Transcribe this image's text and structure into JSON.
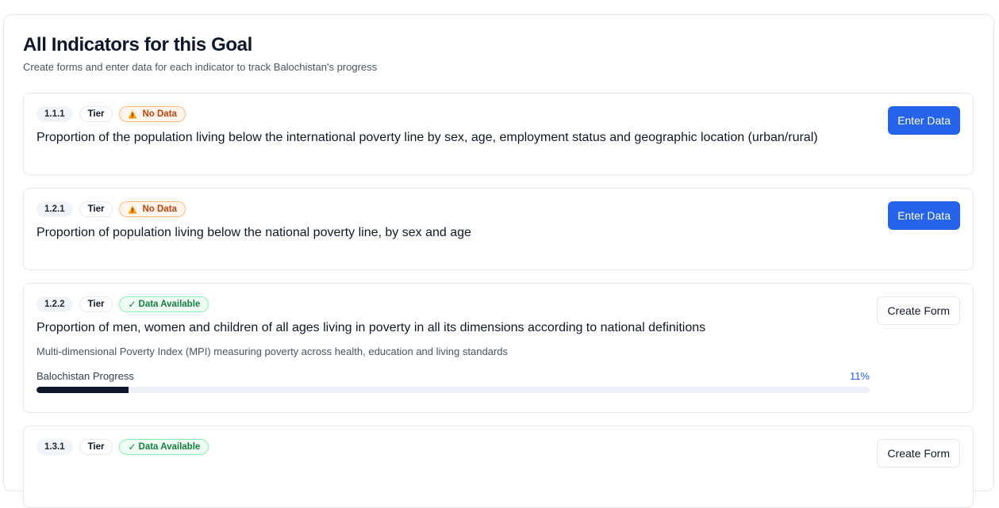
{
  "section": {
    "title": "All Indicators for this Goal",
    "subtitle": "Create forms and enter data for each indicator to track Balochistan's progress"
  },
  "indicators": [
    {
      "id": "1.1.1",
      "tier": "Tier",
      "status": "No Data",
      "status_icon": "warning-icon",
      "title": "Proportion of the population living below the international poverty line by sex, age, employment status and geographic location (urban/rural)",
      "action": "Enter Data"
    },
    {
      "id": "1.2.1",
      "tier": "Tier",
      "status": "No Data",
      "status_icon": "warning-icon",
      "title": "Proportion of population living below the national poverty line, by sex and age",
      "action": "Enter Data"
    },
    {
      "id": "1.2.2",
      "tier": "Tier",
      "status": "Data Available",
      "status_icon": "check-icon",
      "title": "Proportion of men, women and children of all ages living in poverty in all its dimensions according to national definitions",
      "description": "Multi-dimensional Poverty Index (MPI) measuring poverty across health, education and living standards",
      "progress_label": "Balochistan Progress",
      "progress_value": "11%",
      "progress_fraction": 0.11,
      "action": "Create Form"
    },
    {
      "id": "1.3.1",
      "tier": "Tier",
      "status": "Data Available",
      "status_icon": "check-icon",
      "action": "Create Form"
    }
  ],
  "colors": {
    "primary": "#2563eb",
    "warning": "#c2410c",
    "success": "#15803d",
    "progress": "#0f172a"
  }
}
